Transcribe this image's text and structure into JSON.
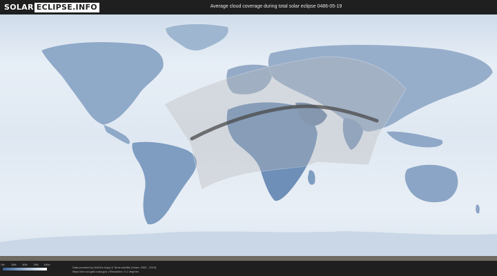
{
  "header": {
    "logo_part1": "SOLAR",
    "logo_part2": "ECLIPSE.INFO",
    "title": "Average cloud coverage during total solar eclipse 0486-05-19"
  },
  "legend": {
    "ticks": [
      "0%",
      "25%",
      "50%",
      "75%",
      "100%"
    ],
    "gradient_colors": [
      "#3a5f8f",
      "#7e9dc1",
      "#c4d4e6",
      "#ffffff"
    ]
  },
  "footer": {
    "credit_line1": "Data provided by NASA's Aqua & Terra satellite (Years: 2000 - 2019)",
    "credit_line2": "https://neo.sci.gsfc.nasa.gov  |  Resolution: 0.1 degrees"
  },
  "colors": {
    "background": "#1f1f1f",
    "ocean_cloud": "#dbe6f1",
    "land": "#7e9dc1",
    "eclipse_path": "#4a4a4a",
    "visibility_zone": "#b8b8b8"
  },
  "map": {
    "eclipse_date": "0486-05-19"
  }
}
